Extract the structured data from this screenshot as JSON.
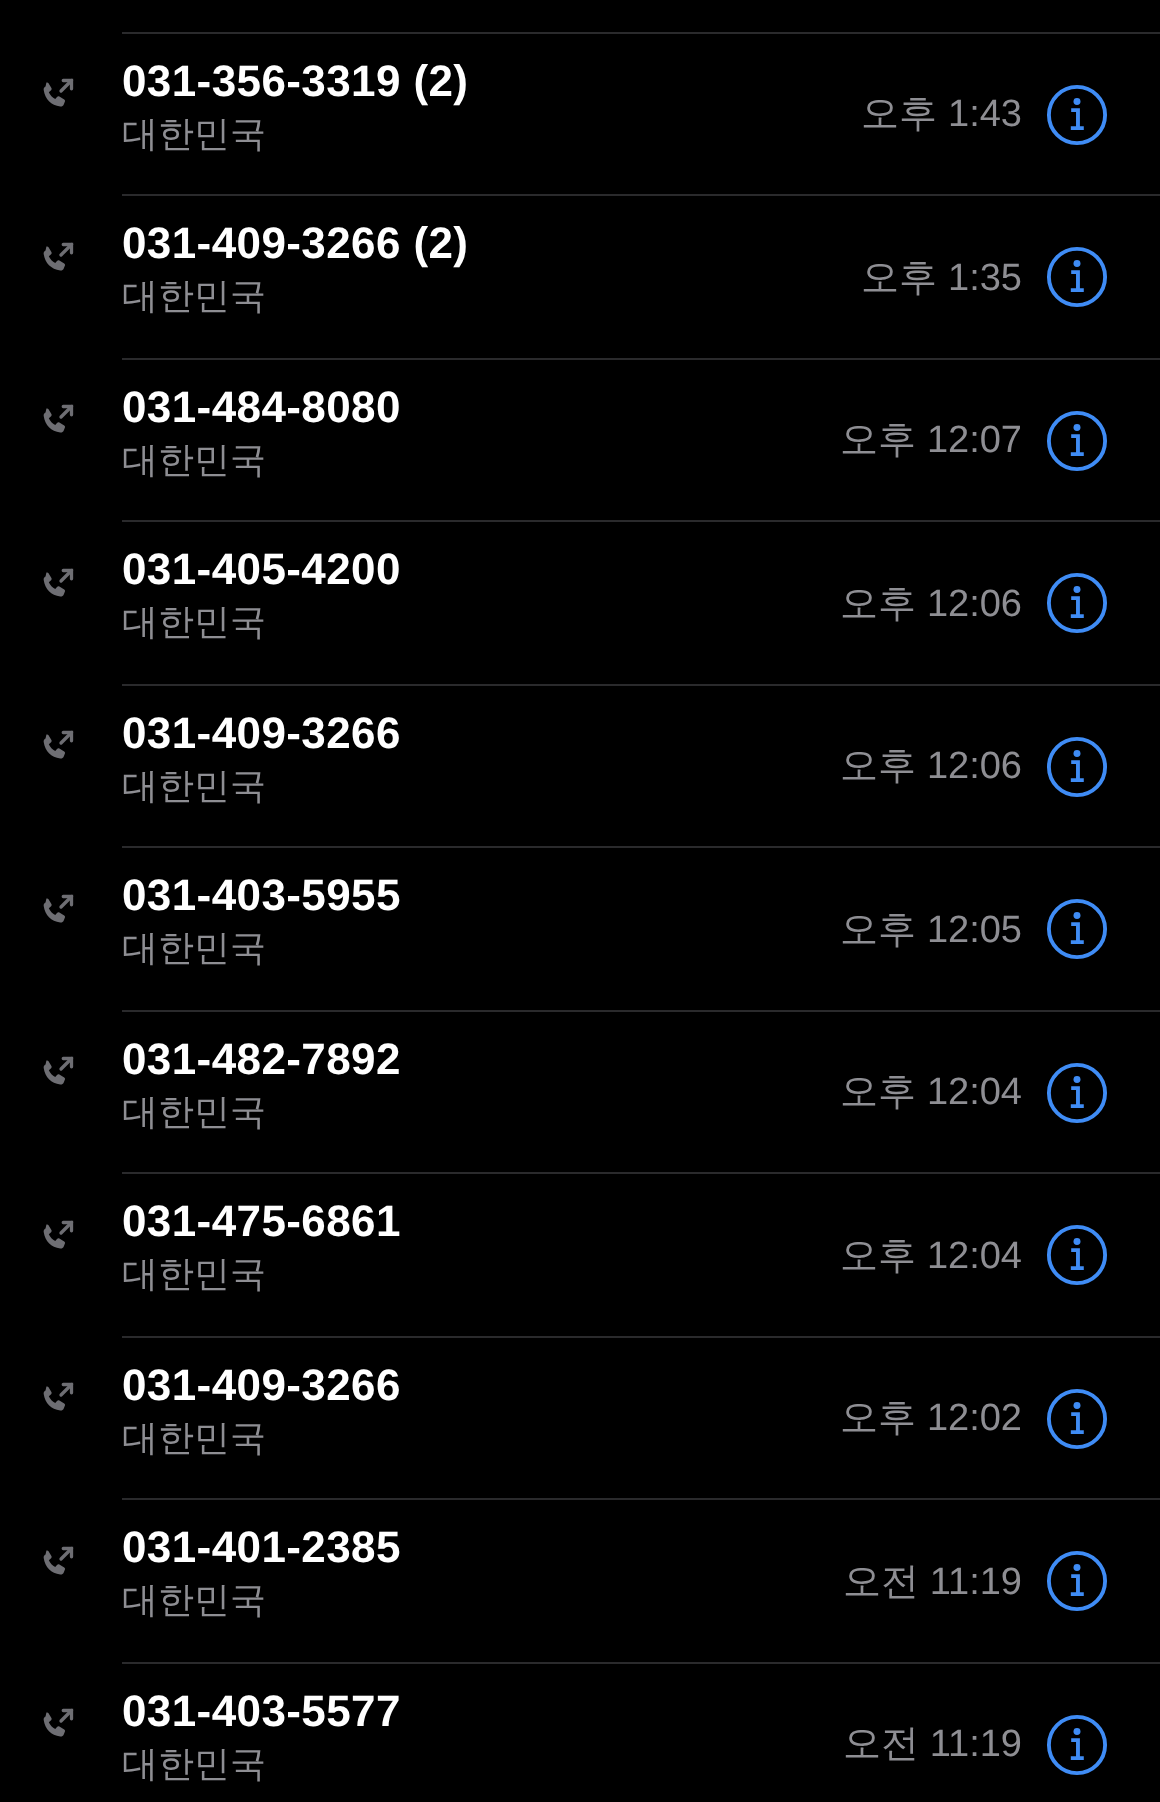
{
  "calls": [
    {
      "number": "031-356-3319 (2)",
      "location": "대한민국",
      "time": "오후 1:43"
    },
    {
      "number": "031-409-3266 (2)",
      "location": "대한민국",
      "time": "오후 1:35"
    },
    {
      "number": "031-484-8080",
      "location": "대한민국",
      "time": "오후 12:07"
    },
    {
      "number": "031-405-4200",
      "location": "대한민국",
      "time": "오후 12:06"
    },
    {
      "number": "031-409-3266",
      "location": "대한민국",
      "time": "오후 12:06"
    },
    {
      "number": "031-403-5955",
      "location": "대한민국",
      "time": "오후 12:05"
    },
    {
      "number": "031-482-7892",
      "location": "대한민국",
      "time": "오후 12:04"
    },
    {
      "number": "031-475-6861",
      "location": "대한민국",
      "time": "오후 12:04"
    },
    {
      "number": "031-409-3266",
      "location": "대한민국",
      "time": "오후 12:02"
    },
    {
      "number": "031-401-2385",
      "location": "대한민국",
      "time": "오전 11:19"
    },
    {
      "number": "031-403-5577",
      "location": "대한민국",
      "time": "오전 11:19"
    }
  ]
}
